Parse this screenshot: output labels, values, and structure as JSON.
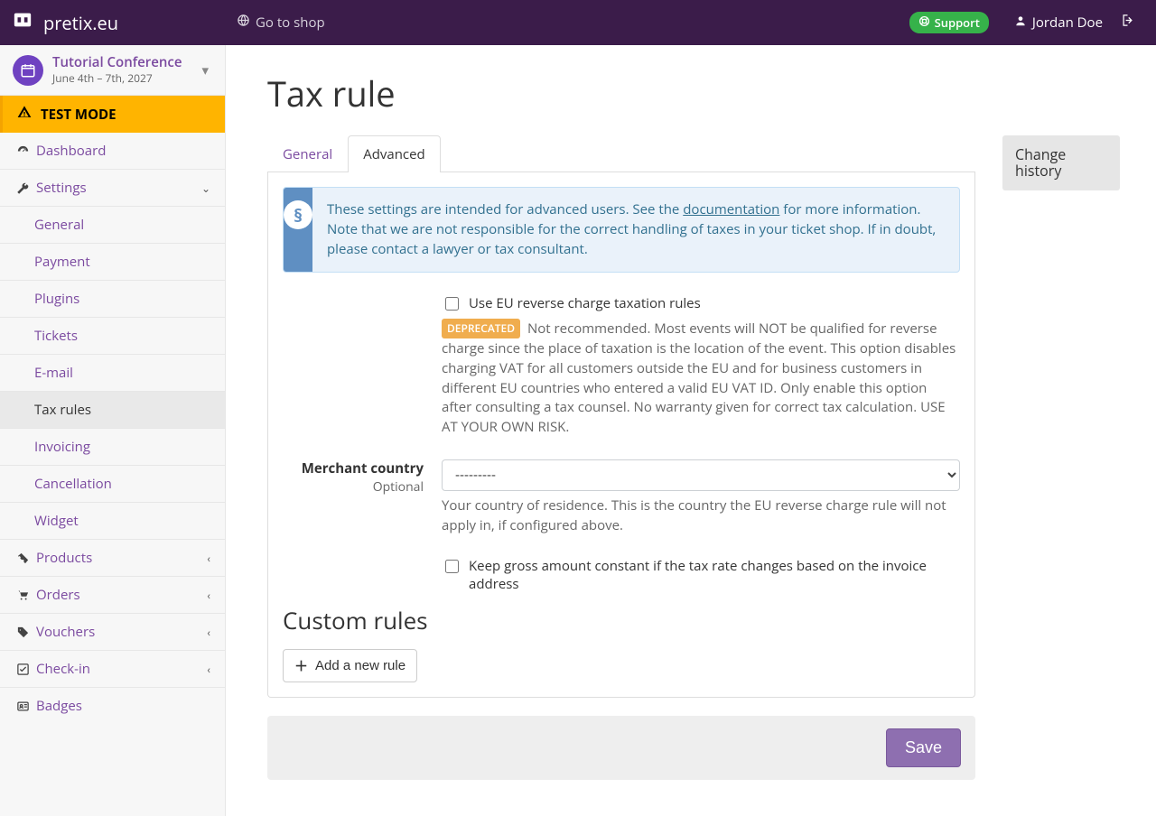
{
  "navbar": {
    "brand": "pretix.eu",
    "goto_shop": "Go to shop",
    "support": "Support",
    "username": "Jordan Doe"
  },
  "event": {
    "name": "Tutorial Conference",
    "daterange": "June 4th – 7th, 2027"
  },
  "testmode": {
    "label": "TEST MODE"
  },
  "sidenav": {
    "dashboard": "Dashboard",
    "settings": "Settings",
    "settings_items": {
      "general": "General",
      "payment": "Payment",
      "plugins": "Plugins",
      "tickets": "Tickets",
      "email": "E-mail",
      "taxrules": "Tax rules",
      "invoicing": "Invoicing",
      "cancellation": "Cancellation",
      "widget": "Widget"
    },
    "products": "Products",
    "orders": "Orders",
    "vouchers": "Vouchers",
    "checkin": "Check-in",
    "badges": "Badges"
  },
  "page": {
    "title": "Tax rule",
    "tabs": {
      "general": "General",
      "advanced": "Advanced"
    },
    "change_history": "Change history"
  },
  "info": {
    "pre": "These settings are intended for advanced users. See the ",
    "link": "documentation",
    "post": " for more information. Note that we are not responsible for the correct handling of taxes in your ticket shop. If in doubt, please contact a lawyer or tax consultant."
  },
  "form": {
    "reverse_charge": {
      "label": "Use EU reverse charge taxation rules",
      "checked": false,
      "deprecated_badge": "DEPRECATED",
      "help": "Not recommended. Most events will NOT be qualified for reverse charge since the place of taxation is the location of the event. This option disables charging VAT for all customers outside the EU and for business customers in different EU countries who entered a valid EU VAT ID. Only enable this option after consulting a tax counsel. No warranty given for correct tax calculation. USE AT YOUR OWN RISK."
    },
    "merchant_country": {
      "label": "Merchant country",
      "optional": "Optional",
      "value": "---------",
      "help": "Your country of residence. This is the country the EU reverse charge rule will not apply in, if configured above."
    },
    "keep_gross": {
      "label": "Keep gross amount constant if the tax rate changes based on the invoice address",
      "checked": false
    },
    "custom_rules_heading": "Custom rules",
    "add_rule": "Add a new rule",
    "save": "Save"
  }
}
